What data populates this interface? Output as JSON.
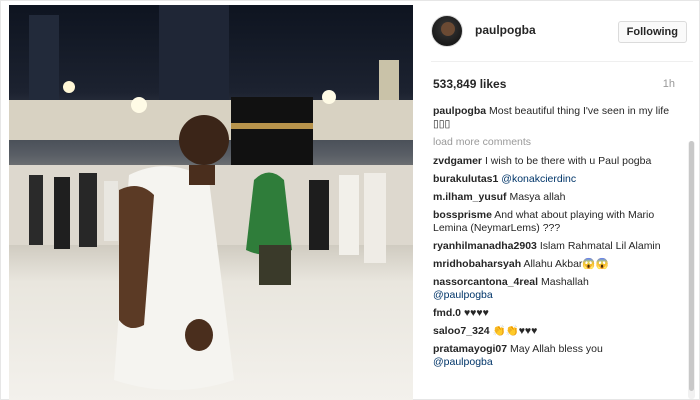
{
  "post": {
    "username": "paulpogba",
    "follow_label": "Following",
    "likes": "533,849 likes",
    "time": "1h",
    "load_more": "load more comments",
    "caption": {
      "user": "paulpogba",
      "text": "Most beautiful thing I've seen in my life ▯▯▯"
    },
    "comments": [
      {
        "user": "zvdgamer",
        "text": "I wish to be there with u Paul pogba",
        "mention": ""
      },
      {
        "user": "burakulutas1",
        "text": "",
        "mention": "@konakcierdinc"
      },
      {
        "user": "m.ilham_yusuf",
        "text": "Masya allah",
        "mention": ""
      },
      {
        "user": "bossprisme",
        "text": "And what about playing with Mario Lemina (NeymarLems) ???",
        "mention": ""
      },
      {
        "user": "ryanhilmanadha2903",
        "text": "Islam Rahmatal Lil Alamin",
        "mention": ""
      },
      {
        "user": "mridhobaharsyah",
        "text": "Allahu Akbar😱😱",
        "mention": ""
      },
      {
        "user": "nassorcantona_4real",
        "text": "Mashallah",
        "mention": "@paulpogba"
      },
      {
        "user": "fmd.0",
        "text": "♥♥♥♥",
        "mention": ""
      },
      {
        "user": "saloo7_324",
        "text": "👏👏♥♥♥",
        "mention": ""
      },
      {
        "user": "pratamayogi07",
        "text": "May Allah bless you",
        "mention": "@paulpogba"
      }
    ]
  },
  "icons": {
    "avatar": "profile-avatar",
    "photo": "post-photo"
  },
  "colors": {
    "mention": "#003569",
    "muted": "#999999",
    "text": "#262626"
  }
}
